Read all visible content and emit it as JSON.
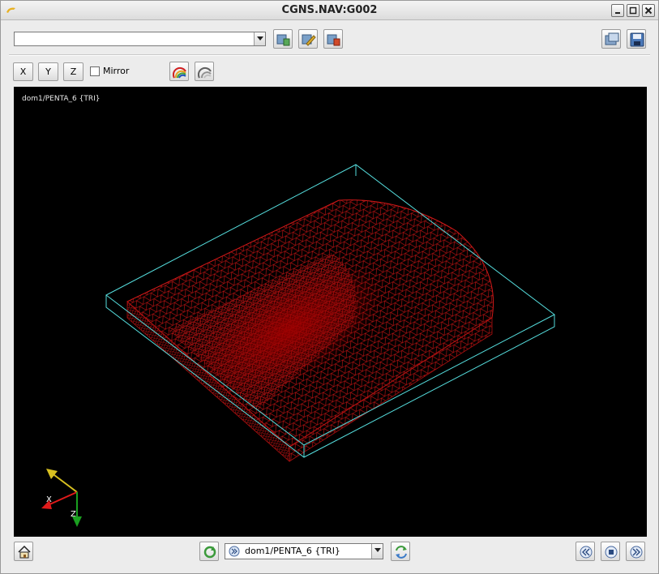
{
  "window": {
    "title": "CGNS.NAV:G002"
  },
  "toolbar_top": {
    "selector_value": "",
    "buttons": [
      "add-view-icon",
      "edit-view-icon",
      "delete-view-icon",
      "snapshot-icon",
      "save-icon"
    ]
  },
  "toolbar_axes": {
    "x_label": "X",
    "y_label": "Y",
    "z_label": "Z",
    "mirror_label": "Mirror",
    "mirror_checked": false,
    "buttons": [
      "color-rainbow-icon",
      "color-grey-icon"
    ]
  },
  "viewport": {
    "label": "dom1/PENTA_6 {TRI}",
    "axis_labels": {
      "x": "X",
      "z": "Z"
    },
    "colors": {
      "background": "#000000",
      "mesh": "#cc0000",
      "bbox": "#55dddd"
    }
  },
  "toolbar_bottom": {
    "selector_value": "dom1/PENTA_6 {TRI}",
    "buttons": [
      "home-icon",
      "refresh-icon",
      "cycle-icon",
      "rewind-icon",
      "stop-icon",
      "forward-icon"
    ]
  }
}
